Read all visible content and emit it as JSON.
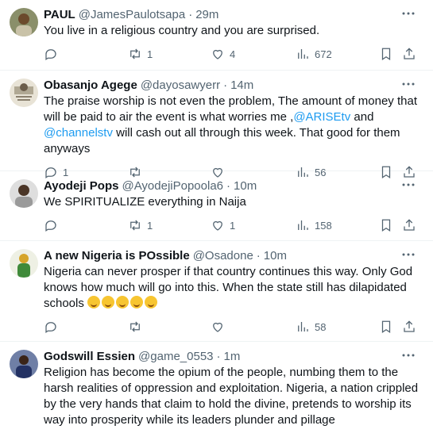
{
  "tweets": [
    {
      "name": "PAUL",
      "handle": "@JamesPaulotsapa",
      "time": "29m",
      "text": "You live in a religious country and you are surprised.",
      "replies": "",
      "retweets": "1",
      "likes": "4",
      "views": "672",
      "avatar_color": "#7b6a3e"
    },
    {
      "name": "Obasanjo Agege",
      "handle": "@dayosawyerr",
      "time": "14m",
      "text_parts": [
        "The praise worship is not even the problem, The amount of money that will be paid to air the event is what worries me ,",
        "@ARISEtv",
        " and ",
        "@channelstv",
        " will cash out all through this week. That good for them anyways"
      ],
      "replies": "1",
      "retweets": "",
      "likes": "",
      "views": "56",
      "avatar_color": "#d9d3c4"
    },
    {
      "name": "Ayodeji Pops",
      "handle": "@AyodejiPopoola6",
      "time": "10m",
      "text": "We SPIRITUALIZE everything in Naija",
      "replies": "",
      "retweets": "1",
      "likes": "1",
      "views": "158",
      "avatar_color": "#b9b9b9"
    },
    {
      "name": "A new Nigeria is POssible",
      "handle": "@Osadone",
      "time": "10m",
      "text": "Nigeria can never prosper if that country continues this way. Only God knows how much will go into this. When the state still has dilapidated schools",
      "emoji_count": 5,
      "replies": "",
      "retweets": "",
      "likes": "",
      "views": "58",
      "avatar_color": "#c9a63a"
    },
    {
      "name": "Godswill Essien",
      "handle": "@game_0553",
      "time": "1m",
      "text": "Religion has become the opium of the people, numbing them to the harsh realities of oppression and exploitation. Nigeria, a nation crippled by the very hands that claim to hold the divine, pretends to worship its way into prosperity while its leaders plunder and pillage",
      "avatar_color": "#2b3a6b"
    }
  ],
  "ui": {
    "more": "···",
    "dot": "·"
  }
}
